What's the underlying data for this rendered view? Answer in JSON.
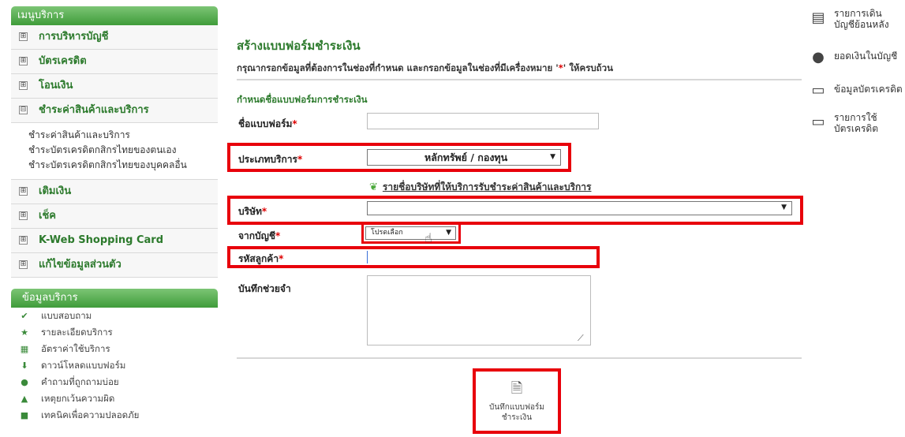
{
  "sidebar": {
    "menu_header": "เมนูบริการ",
    "menu_items": [
      {
        "sign": "⊞",
        "label": "การบริหารบัญชี"
      },
      {
        "sign": "⊞",
        "label": "บัตรเครดิต"
      },
      {
        "sign": "⊞",
        "label": "โอนเงิน"
      },
      {
        "sign": "⊟",
        "label": "ชำระค่าสินค้าและบริการ"
      }
    ],
    "submenu": [
      "ชำระค่าสินค้าและบริการ",
      "ชำระบัตรเครดิตกสิกรไทยของตนเอง",
      "ชำระบัตรเครดิตกสิกรไทยของบุคคลอื่น"
    ],
    "menu_items_after": [
      {
        "sign": "⊞",
        "label": "เติมเงิน"
      },
      {
        "sign": "⊞",
        "label": "เช็ค"
      },
      {
        "sign": "⊞",
        "label": "K-Web Shopping Card"
      },
      {
        "sign": "⊞",
        "label": "แก้ไขข้อมูลส่วนตัว"
      }
    ],
    "info_header": "ข้อมูลบริการ",
    "info_items": [
      {
        "icon": "check-icon",
        "glyph": "✔",
        "label": "แบบสอบถาม"
      },
      {
        "icon": "star-icon",
        "glyph": "★",
        "label": "รายละเอียดบริการ"
      },
      {
        "icon": "calculator-icon",
        "glyph": "▦",
        "label": "อัตราค่าใช้บริการ"
      },
      {
        "icon": "download-icon",
        "glyph": "⬇",
        "label": "ดาวน์โหลดแบบฟอร์ม"
      },
      {
        "icon": "question-icon",
        "glyph": "●",
        "label": "คำถามที่ถูกถามบ่อย"
      },
      {
        "icon": "warning-icon",
        "glyph": "▲",
        "label": "เหตุยกเว้นความผิด"
      },
      {
        "icon": "lock-icon",
        "glyph": "■",
        "label": "เทคนิคเพื่อความปลอดภัย"
      }
    ]
  },
  "form": {
    "title": "สร้างแบบฟอร์มชำระเงิน",
    "note": "กรุณากรอกข้อมูลที่ต้องการในช่องที่กำหนด และกรอกข้อมูลในช่องที่มีเครื่องหมาย '",
    "note_star": "*",
    "note_end": "' ให้ครบถ้วน",
    "section_title": "กำหนดชื่อแบบฟอร์มการชำระเงิน",
    "required_mark": "*",
    "labels": {
      "form_name": "ชื่อแบบฟอร์ม",
      "service_type": "ประเภทบริการ",
      "company": "บริษัท",
      "from_account": "จากบัญชี",
      "customer_code": "รหัสลูกค้า",
      "memo": "บันทึกช่วยจำ"
    },
    "service_type_value": "หลักทรัพย์ / กองทุน",
    "company_value": "",
    "from_account_value": "โปรดเลือก",
    "form_name_value": "",
    "customer_code_value": "",
    "memo_value": "",
    "company_list_link": "รายชื่อบริษัทที่ให้บริการรับชำระค่าสินค้าและบริการ",
    "save_button": "บันทึกแบบฟอร์ม",
    "save_button_line2": "ชำระเงิน"
  },
  "right_links": [
    {
      "icon": "history-icon",
      "glyph": "▤",
      "line1": "รายการเดิน",
      "line2": "บัญชีย้อนหลัง"
    },
    {
      "icon": "money-bag-icon",
      "glyph": "●",
      "line1": "ยอดเงินในบัญชี",
      "line2": ""
    },
    {
      "icon": "credit-card-icon",
      "glyph": "▭",
      "line1": "ข้อมูลบัตรเครดิต",
      "line2": ""
    },
    {
      "icon": "card-usage-icon",
      "glyph": "▭",
      "line1": "รายการใช้",
      "line2": "บัตรเครดิต"
    }
  ],
  "colors": {
    "accent_green": "#3f9c3a",
    "highlight_red": "#e8000b",
    "required_red": "#dd0000"
  }
}
